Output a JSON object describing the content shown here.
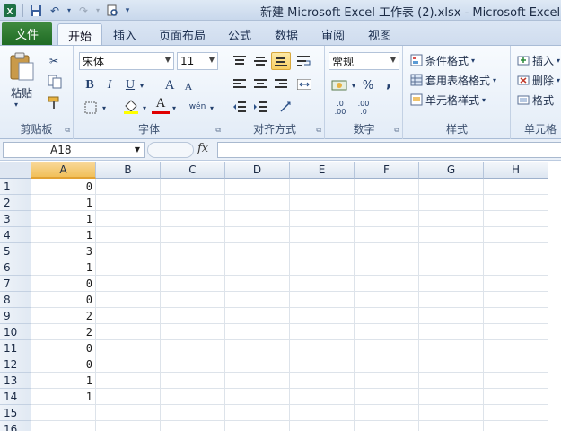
{
  "title_bar": {
    "title": "新建 Microsoft Excel 工作表 (2).xlsx - Microsoft Excel"
  },
  "tabs": [
    {
      "label": "文件"
    },
    {
      "label": "开始"
    },
    {
      "label": "插入"
    },
    {
      "label": "页面布局"
    },
    {
      "label": "公式"
    },
    {
      "label": "数据"
    },
    {
      "label": "审阅"
    },
    {
      "label": "视图"
    }
  ],
  "ribbon": {
    "clipboard": {
      "label": "剪贴板",
      "paste": "粘贴"
    },
    "font": {
      "label": "字体",
      "name": "宋体",
      "size": "11",
      "bold": "B",
      "italic": "I",
      "underline": "U",
      "grow": "A",
      "shrink": "A",
      "font_color": "A",
      "phonetic": "wén"
    },
    "alignment": {
      "label": "对齐方式"
    },
    "number": {
      "label": "数字",
      "format": "常规",
      "percent": "%",
      "comma": ",",
      "inc_dec": ".0",
      "inc_dec2": ".00",
      "dec_dec": ".00",
      "dec_dec2": ".0"
    },
    "styles": {
      "label": "样式",
      "conditional": "条件格式",
      "table": "套用表格格式",
      "cell_styles": "单元格样式"
    },
    "cells": {
      "label": "单元格",
      "insert": "插入",
      "delete": "删除",
      "format": "格式"
    }
  },
  "formula_bar": {
    "name_box": "A18",
    "fx": "fx",
    "value": ""
  },
  "grid": {
    "columns": [
      "A",
      "B",
      "C",
      "D",
      "E",
      "F",
      "G",
      "H"
    ],
    "selected_column": "A",
    "rows": [
      "1",
      "2",
      "3",
      "4",
      "5",
      "6",
      "7",
      "8",
      "9",
      "10",
      "11",
      "12",
      "13",
      "14",
      "15",
      "16"
    ],
    "col_a_values": [
      "0",
      "1",
      "1",
      "1",
      "3",
      "1",
      "0",
      "0",
      "2",
      "2",
      "0",
      "0",
      "1",
      "1",
      "",
      ""
    ]
  },
  "colors": {
    "file_tab": "#1f6b24",
    "selected_header": "#f1c05a",
    "ribbon_bg": "#e3ecf7"
  }
}
